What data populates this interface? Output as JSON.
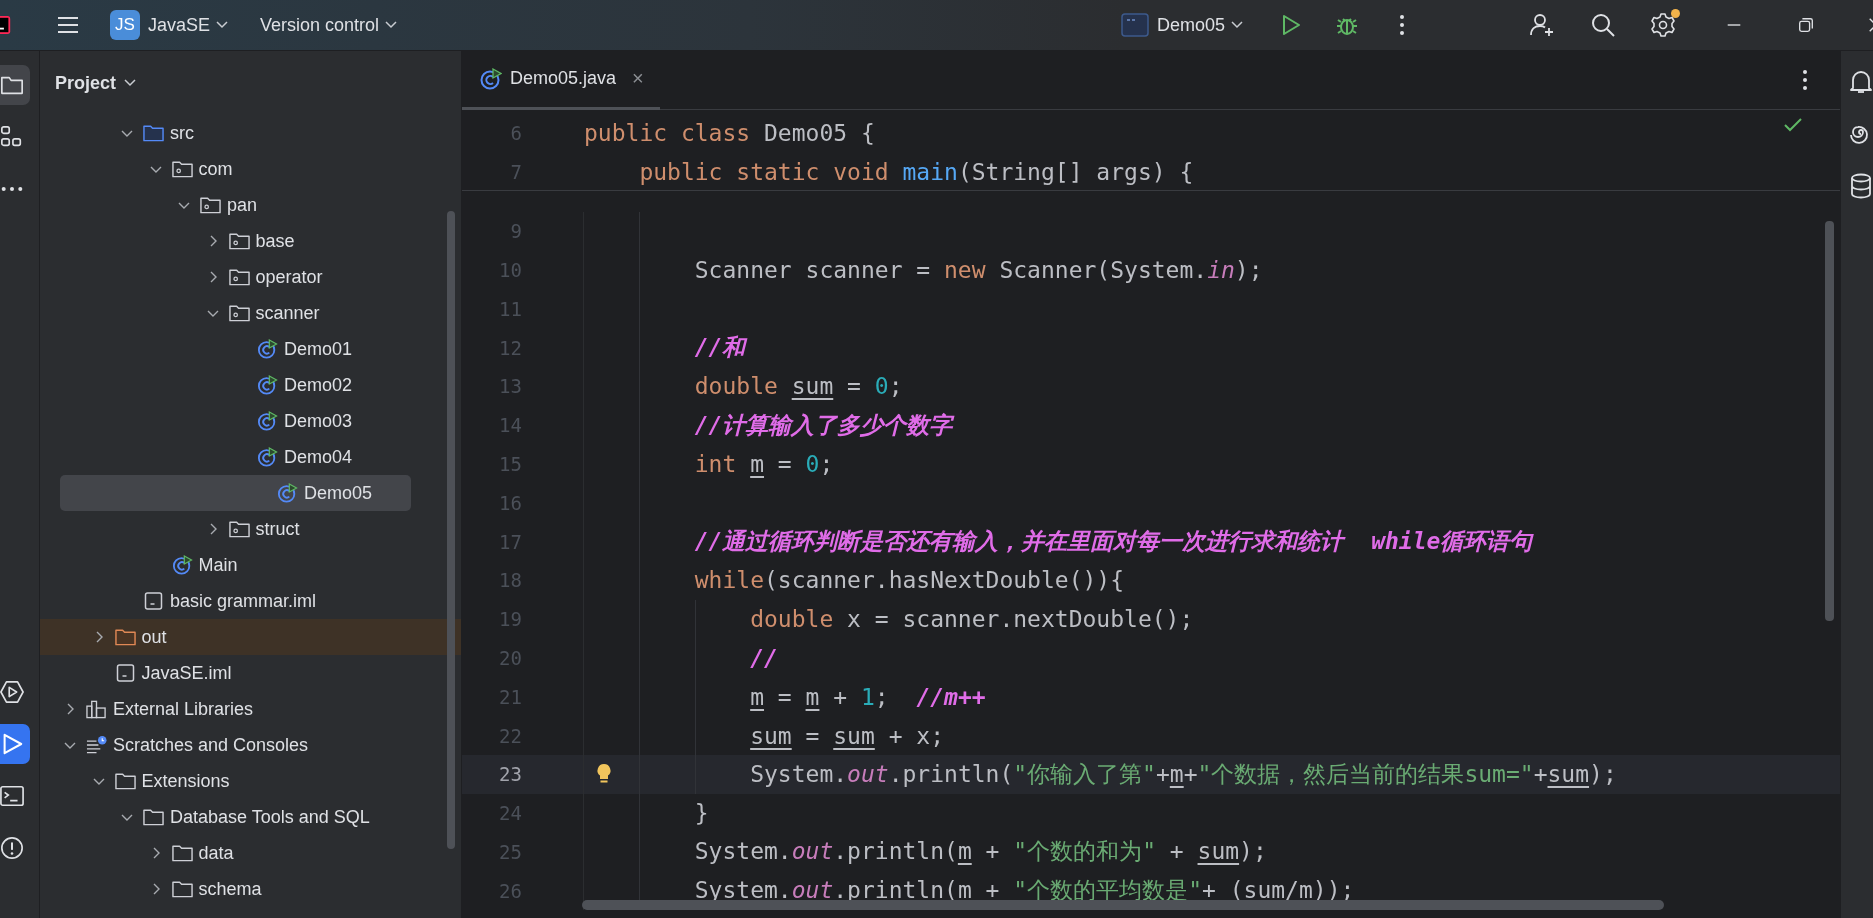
{
  "title_bar": {
    "project_badge": "JS",
    "project": "JavaSE",
    "vcs": "Version control",
    "run_config": "Demo05",
    "settings_notification": true
  },
  "left_toolbar": {
    "top": [
      {
        "kind": "project",
        "selected": true
      },
      {
        "kind": "structure",
        "selected": false
      },
      {
        "kind": "more",
        "selected": false
      }
    ],
    "bottom": [
      {
        "kind": "services",
        "selected": false
      },
      {
        "kind": "run",
        "selected": true
      },
      {
        "kind": "terminal",
        "selected": false
      },
      {
        "kind": "problems",
        "selected": false
      }
    ]
  },
  "project_panel": {
    "title": "Project",
    "tree": [
      {
        "children": [
          {
            "children": [
              {
                "label": "src",
                "kind": "source-root",
                "expanded": true,
                "selected": false,
                "children": [
                  {
                    "label": "com",
                    "kind": "package",
                    "expanded": true,
                    "selected": false,
                    "children": [
                      {
                        "label": "pan",
                        "kind": "package",
                        "expanded": true,
                        "selected": false,
                        "children": [
                          {
                            "label": "base",
                            "kind": "package",
                            "expanded": false,
                            "selected": false
                          },
                          {
                            "label": "operator",
                            "kind": "package",
                            "expanded": false,
                            "selected": false
                          },
                          {
                            "label": "scanner",
                            "kind": "package",
                            "expanded": true,
                            "selected": false,
                            "children": [
                              {
                                "label": "Demo01",
                                "kind": "class",
                                "selected": false
                              },
                              {
                                "label": "Demo02",
                                "kind": "class",
                                "selected": false
                              },
                              {
                                "label": "Demo03",
                                "kind": "class",
                                "selected": false
                              },
                              {
                                "label": "Demo04",
                                "kind": "class",
                                "selected": false
                              },
                              {
                                "label": "Demo05",
                                "kind": "class",
                                "selected": true
                              }
                            ]
                          },
                          {
                            "label": "struct",
                            "kind": "package",
                            "expanded": false,
                            "selected": false
                          }
                        ]
                      }
                    ]
                  },
                  {
                    "label": "Main",
                    "kind": "class",
                    "selected": false
                  }
                ]
              },
              {
                "label": "basic grammar.iml",
                "kind": "module-file",
                "selected": false
              }
            ]
          },
          {
            "label": "out",
            "kind": "excluded-folder",
            "expanded": false,
            "selected": false
          },
          {
            "label": "JavaSE.iml",
            "kind": "module-file",
            "selected": false
          }
        ]
      },
      {
        "label": "External Libraries",
        "kind": "libraries",
        "expanded": false,
        "selected": false
      },
      {
        "label": "Scratches and Consoles",
        "kind": "scratches",
        "expanded": true,
        "selected": false,
        "children": [
          {
            "label": "Extensions",
            "kind": "folder",
            "expanded": true,
            "selected": false,
            "children": [
              {
                "label": "Database Tools and SQL",
                "kind": "folder",
                "expanded": true,
                "selected": false,
                "children": [
                  {
                    "label": "data",
                    "kind": "folder",
                    "expanded": false,
                    "selected": false
                  },
                  {
                    "label": "schema",
                    "kind": "folder",
                    "expanded": false,
                    "selected": false
                  }
                ]
              }
            ]
          }
        ]
      }
    ]
  },
  "editor": {
    "tabs": [
      {
        "label": "Demo05.java",
        "close": "×",
        "selected": true
      }
    ],
    "sticky_lines": [
      {
        "number": "6",
        "kind": "file",
        "tokens": [
          {
            "text": "public class ",
            "kind": "keyword"
          },
          {
            "text": "Demo05 {",
            "kind": "plain"
          }
        ]
      },
      {
        "number": "7",
        "kind": "class-body",
        "tokens": [
          {
            "text": "public static void ",
            "kind": "keyword"
          },
          {
            "text": "main",
            "kind": "declaration"
          },
          {
            "text": "(String[] args) {",
            "kind": "plain"
          }
        ]
      }
    ],
    "lines": [
      {
        "number": "9",
        "kind": "method-body",
        "current": false
      },
      {
        "number": "10",
        "kind": "method-body",
        "current": false,
        "tokens": [
          {
            "text": "Scanner scanner = ",
            "kind": "plain"
          },
          {
            "text": "new",
            "kind": "keyword"
          },
          {
            "text": " Scanner(System.",
            "kind": "plain"
          },
          {
            "text": "in",
            "kind": "field"
          },
          {
            "text": ");",
            "kind": "plain"
          }
        ]
      },
      {
        "number": "11",
        "kind": "method-body",
        "current": false
      },
      {
        "number": "12",
        "kind": "method-body",
        "current": false,
        "tokens": [
          {
            "text": "//和",
            "kind": "comment"
          }
        ]
      },
      {
        "number": "13",
        "kind": "method-body",
        "current": false,
        "tokens": [
          {
            "text": "double ",
            "kind": "keyword"
          },
          {
            "text": "sum",
            "kind": "variable"
          },
          {
            "text": " = ",
            "kind": "plain"
          },
          {
            "text": "0",
            "kind": "number"
          },
          {
            "text": ";",
            "kind": "plain"
          }
        ]
      },
      {
        "number": "14",
        "kind": "method-body",
        "current": false,
        "tokens": [
          {
            "text": "//计算输入了多少个数字",
            "kind": "comment"
          }
        ]
      },
      {
        "number": "15",
        "kind": "method-body",
        "current": false,
        "tokens": [
          {
            "text": "int ",
            "kind": "keyword"
          },
          {
            "text": "m",
            "kind": "variable"
          },
          {
            "text": " = ",
            "kind": "plain"
          },
          {
            "text": "0",
            "kind": "number"
          },
          {
            "text": ";",
            "kind": "plain"
          }
        ]
      },
      {
        "number": "16",
        "kind": "method-body",
        "current": false
      },
      {
        "number": "17",
        "kind": "method-body",
        "current": false,
        "tokens": [
          {
            "text": "//通过循环判断是否还有输入，并在里面对每一次进行求和统计  while循环语句",
            "kind": "comment"
          }
        ]
      },
      {
        "number": "18",
        "kind": "method-body",
        "current": false,
        "tokens": [
          {
            "text": "while",
            "kind": "keyword"
          },
          {
            "text": "(scanner.hasNextDouble()){",
            "kind": "plain"
          }
        ]
      },
      {
        "number": "19",
        "kind": "loop-body",
        "current": false,
        "tokens": [
          {
            "text": "double",
            "kind": "keyword"
          },
          {
            "text": " x = scanner.nextDouble();",
            "kind": "plain"
          }
        ]
      },
      {
        "number": "20",
        "kind": "loop-body",
        "current": false,
        "tokens": [
          {
            "text": "//",
            "kind": "comment"
          }
        ]
      },
      {
        "number": "21",
        "kind": "loop-body",
        "current": false,
        "tokens": [
          {
            "text": "m",
            "kind": "variable"
          },
          {
            "text": " = ",
            "kind": "plain"
          },
          {
            "text": "m",
            "kind": "variable"
          },
          {
            "text": " + ",
            "kind": "plain"
          },
          {
            "text": "1",
            "kind": "number"
          },
          {
            "text": ";  ",
            "kind": "plain"
          },
          {
            "text": "//m++",
            "kind": "comment"
          }
        ]
      },
      {
        "number": "22",
        "kind": "loop-body",
        "current": false,
        "tokens": [
          {
            "text": "sum",
            "kind": "variable"
          },
          {
            "text": " = ",
            "kind": "plain"
          },
          {
            "text": "sum",
            "kind": "variable"
          },
          {
            "text": " + x;",
            "kind": "plain"
          }
        ]
      },
      {
        "number": "23",
        "kind": "loop-body",
        "current": true,
        "tokens": [
          {
            "text": "System.",
            "kind": "plain"
          },
          {
            "text": "out",
            "kind": "field"
          },
          {
            "text": ".println(",
            "kind": "plain"
          },
          {
            "text": "\"你输入了第\"",
            "kind": "string"
          },
          {
            "text": "+",
            "kind": "plain"
          },
          {
            "text": "m",
            "kind": "variable"
          },
          {
            "text": "+",
            "kind": "plain"
          },
          {
            "text": "\"个数据，然后当前的结果sum=\"",
            "kind": "string"
          },
          {
            "text": "+",
            "kind": "plain"
          },
          {
            "text": "sum",
            "kind": "variable"
          },
          {
            "text": ");",
            "kind": "plain"
          }
        ]
      },
      {
        "number": "24",
        "kind": "method-body",
        "current": false,
        "tokens": [
          {
            "text": "}",
            "kind": "plain"
          }
        ]
      },
      {
        "number": "25",
        "kind": "method-body",
        "current": false,
        "tokens": [
          {
            "text": "System.",
            "kind": "plain"
          },
          {
            "text": "out",
            "kind": "field"
          },
          {
            "text": ".println(",
            "kind": "plain"
          },
          {
            "text": "m",
            "kind": "variable"
          },
          {
            "text": " + ",
            "kind": "plain"
          },
          {
            "text": "\"个数的和为\"",
            "kind": "string"
          },
          {
            "text": " + ",
            "kind": "plain"
          },
          {
            "text": "sum",
            "kind": "variable"
          },
          {
            "text": ");",
            "kind": "plain"
          }
        ]
      },
      {
        "number": "26",
        "kind": "method-body",
        "current": false,
        "tokens": [
          {
            "text": "System.",
            "kind": "plain"
          },
          {
            "text": "out",
            "kind": "field"
          },
          {
            "text": ".println(",
            "kind": "plain"
          },
          {
            "text": "m",
            "kind": "variable"
          },
          {
            "text": " + ",
            "kind": "plain"
          },
          {
            "text": "\"个数的平均数是\"",
            "kind": "string"
          },
          {
            "text": "+ (",
            "kind": "plain"
          },
          {
            "text": "sum",
            "kind": "variable"
          },
          {
            "text": "/",
            "kind": "plain"
          },
          {
            "text": "m",
            "kind": "variable"
          },
          {
            "text": "));",
            "kind": "plain"
          }
        ]
      }
    ]
  }
}
